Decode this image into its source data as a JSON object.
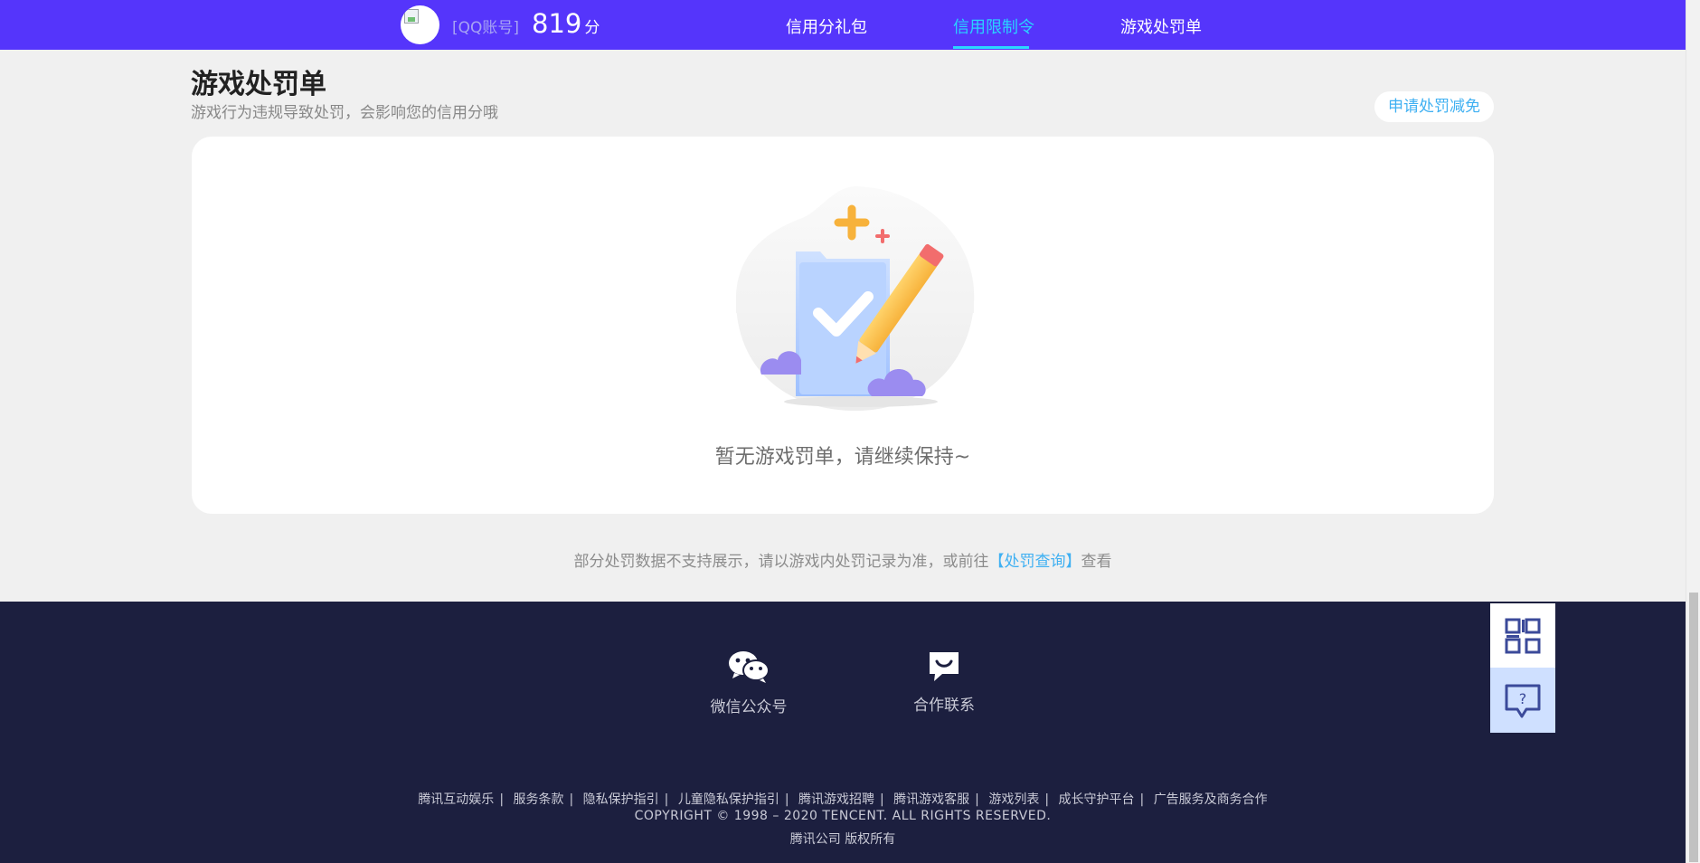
{
  "header": {
    "account_label": "[QQ账号]",
    "score_value": "819",
    "score_unit": "分",
    "nav": [
      "信用分礼包",
      "信用限制令",
      "游戏处罚单"
    ],
    "active_nav": "信用限制令"
  },
  "page": {
    "title": "游戏处罚单",
    "subtitle": "游戏行为违规导致处罚，会影响您的信用分哦",
    "apply_button": "申请处罚减免",
    "empty_text": "暂无游戏罚单，请继续保持~",
    "note_prefix": "部分处罚数据不支持展示，请以游戏内处罚记录为准，或前往",
    "note_link": "【处罚查询】",
    "note_suffix": "查看"
  },
  "footer": {
    "wechat_label": "微信公众号",
    "contact_label": "合作联系",
    "links": [
      "腾讯互动娱乐",
      "服务条款",
      "隐私保护指引",
      "儿童隐私保护指引",
      "腾讯游戏招聘",
      "腾讯游戏客服",
      "游戏列表",
      "成长守护平台",
      "广告服务及商务合作"
    ],
    "copyright": "COPYRIGHT © 1998 – 2020 TENCENT. ALL RIGHTS RESERVED.",
    "company": "腾讯公司 版权所有"
  },
  "icons": {
    "side_top": "qr-code-icon",
    "side_bottom": "help-question-icon",
    "wechat": "wechat-icon",
    "contact": "message-icon"
  },
  "colors": {
    "header_bg": "#5535fb",
    "accent": "#2ad6ff",
    "link": "#3fb0f2",
    "footer_bg": "#1c1f3f"
  }
}
